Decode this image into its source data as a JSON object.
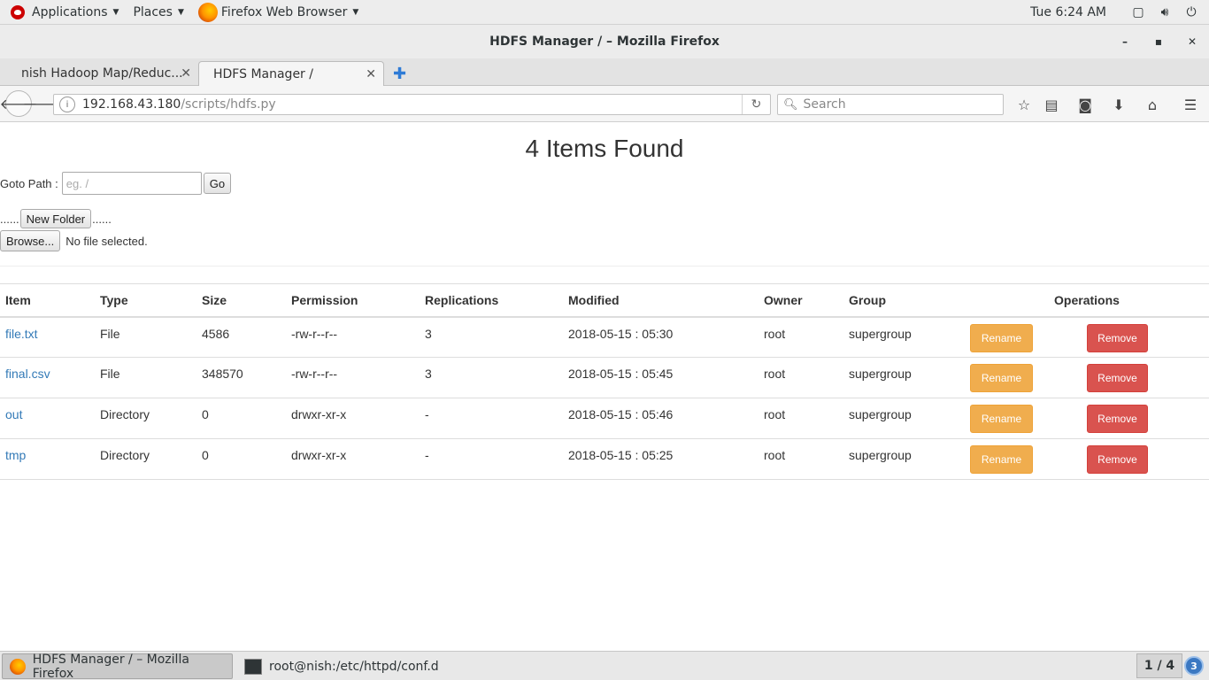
{
  "topbar": {
    "applications": "Applications",
    "places": "Places",
    "active_app": "Firefox Web Browser",
    "clock": "Tue  6:24 AM"
  },
  "window": {
    "title": "HDFS Manager / – Mozilla Firefox"
  },
  "tabs": [
    {
      "label": "nish Hadoop Map/Reduc..."
    },
    {
      "label": "HDFS Manager /"
    }
  ],
  "navbar": {
    "url_host": "192.168.43.180",
    "url_path": "/scripts/hdfs.py",
    "search_placeholder": "Search"
  },
  "page": {
    "title": "4 Items Found",
    "goto_label": "Goto Path :",
    "goto_placeholder": "eg. /",
    "go_label": "Go",
    "dots": "......",
    "new_folder_label": "New Folder",
    "browse_label": "Browse...",
    "no_file_text": "No file selected."
  },
  "table": {
    "headers": [
      "Item",
      "Type",
      "Size",
      "Permission",
      "Replications",
      "Modified",
      "Owner",
      "Group",
      "",
      "Operations"
    ],
    "rename_label": "Rename",
    "remove_label": "Remove",
    "rows": [
      {
        "item": "file.txt",
        "type": "File",
        "size": "4586",
        "permission": "-rw-r--r--",
        "replications": "3",
        "modified": "2018-05-15 : 05:30",
        "owner": "root",
        "group": "supergroup"
      },
      {
        "item": "final.csv",
        "type": "File",
        "size": "348570",
        "permission": "-rw-r--r--",
        "replications": "3",
        "modified": "2018-05-15 : 05:45",
        "owner": "root",
        "group": "supergroup"
      },
      {
        "item": "out",
        "type": "Directory",
        "size": "0",
        "permission": "drwxr-xr-x",
        "replications": "-",
        "modified": "2018-05-15 : 05:46",
        "owner": "root",
        "group": "supergroup"
      },
      {
        "item": "tmp",
        "type": "Directory",
        "size": "0",
        "permission": "drwxr-xr-x",
        "replications": "-",
        "modified": "2018-05-15 : 05:25",
        "owner": "root",
        "group": "supergroup"
      }
    ]
  },
  "taskbar": {
    "items": [
      {
        "label": "HDFS Manager / – Mozilla Firefox"
      },
      {
        "label": "root@nish:/etc/httpd/conf.d"
      }
    ],
    "workspace": "1 / 4",
    "notifications": "3"
  },
  "colors": {
    "rename": "#f0ad4e",
    "remove": "#d9534f",
    "link": "#337ab7"
  }
}
